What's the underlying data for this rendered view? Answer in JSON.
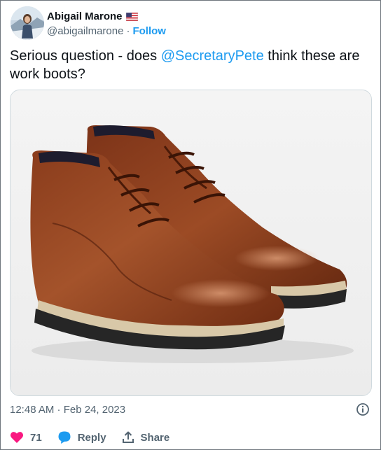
{
  "author": {
    "display_name": "Abigail Marone",
    "handle": "@abigailmarone",
    "separator": "·",
    "follow_label": "Follow",
    "flag_icon": "us-flag-icon"
  },
  "tweet": {
    "text_before": "Serious question - does ",
    "mention": "@SecretaryPete",
    "text_after": " think these are work boots?"
  },
  "media": {
    "subject": "brown-leather-chukka-boots-image"
  },
  "meta": {
    "timestamp": "12:48 AM · Feb 24, 2023"
  },
  "actions": {
    "like_count": "71",
    "reply_label": "Reply",
    "share_label": "Share"
  },
  "colors": {
    "accent": "#1d9bf0",
    "like": "#f91880",
    "text": "#0f1419",
    "muted": "#536471"
  }
}
